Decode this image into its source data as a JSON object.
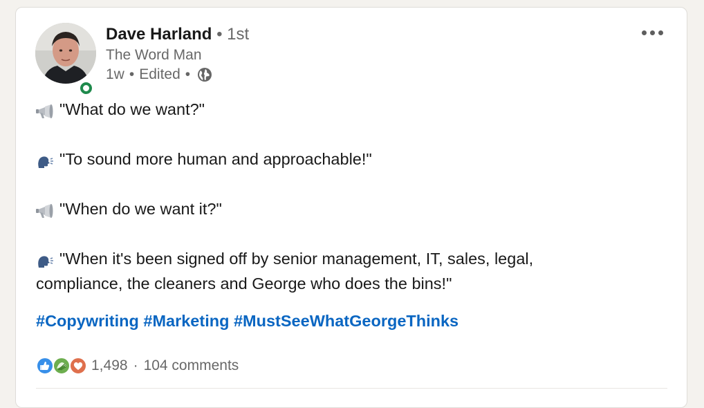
{
  "post": {
    "author": {
      "name": "Dave Harland",
      "degree_separator": "•",
      "degree": "1st",
      "headline": "The Word Man",
      "time": "1w",
      "edited": "Edited",
      "meta_separator": "•",
      "visibility_icon": "globe-icon"
    },
    "lines": [
      {
        "icon": "megaphone-icon",
        "text": "\"What do we want?\""
      },
      {
        "icon": "speaking-head-icon",
        "text": "\"To sound more human and approachable!\""
      },
      {
        "icon": "megaphone-icon",
        "text": "\"When do we want it?\""
      },
      {
        "icon": "speaking-head-icon",
        "text": "\"When it's been signed off by senior management, IT, sales, legal,"
      },
      {
        "icon": null,
        "text": "compliance, the cleaners and George who does the bins!\""
      }
    ],
    "hashtags": [
      "#Copywriting",
      "#Marketing",
      "#MustSeeWhatGeorgeThinks"
    ],
    "social": {
      "reaction_icons": [
        "like-icon",
        "support-icon",
        "love-icon"
      ],
      "reaction_count": "1,498",
      "separator": "·",
      "comments": "104 comments"
    }
  },
  "colors": {
    "link": "#0a66c2",
    "presence": "#1f8a4c",
    "like": "#378fe9",
    "support": "#6dae4f",
    "love": "#df704d"
  }
}
